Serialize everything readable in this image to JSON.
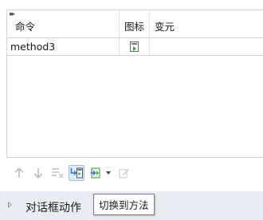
{
  "table": {
    "columns": [
      {
        "key": "command",
        "label": "命令"
      },
      {
        "key": "icon",
        "label": "图标"
      },
      {
        "key": "variable",
        "label": "变元"
      }
    ],
    "rows": [
      {
        "command": "method3",
        "icon": "method-icon",
        "variable": ""
      }
    ]
  },
  "toolbar": {
    "buttons": [
      {
        "icon": "arrow-up-icon",
        "enabled": false
      },
      {
        "icon": "arrow-down-icon",
        "enabled": false
      },
      {
        "icon": "list-remove-icon",
        "enabled": false
      },
      {
        "icon": "switch-to-method-icon",
        "enabled": true,
        "active": true
      },
      {
        "icon": "extract-to-method-icon",
        "enabled": true,
        "has_dropdown": true
      },
      {
        "icon": "edit-icon",
        "enabled": false
      }
    ]
  },
  "section": {
    "label": "对话框动作"
  },
  "tooltip": {
    "text": "切换到方法"
  },
  "colors": {
    "accent": "#3a7fc6",
    "section_bg": "#e9ecf3",
    "border": "#d4d4d4"
  }
}
